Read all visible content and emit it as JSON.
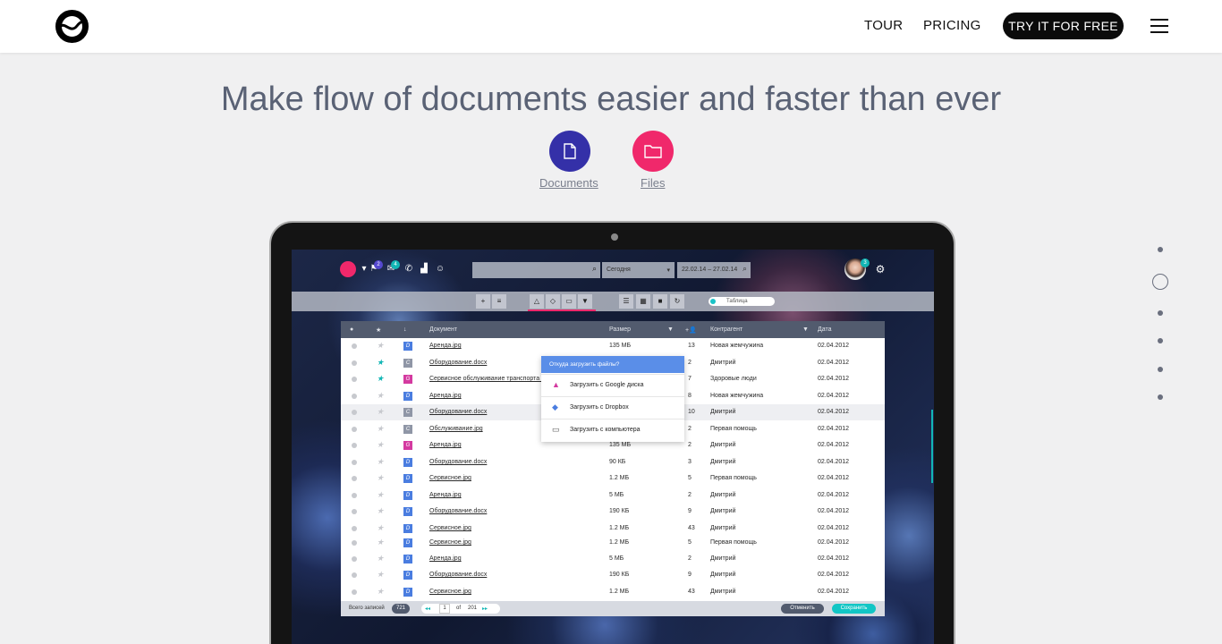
{
  "nav": {
    "tour": "TOUR",
    "pricing": "PRICING",
    "cta": "TRY IT FOR FREE"
  },
  "hero": {
    "headline": "Make flow of documents easier and faster than ever"
  },
  "features": [
    {
      "label": "Documents",
      "color": "#3430a8"
    },
    {
      "label": "Files",
      "color": "#f0286b"
    }
  ],
  "app": {
    "search_icon": "search-icon",
    "period_select": "Сегодня",
    "date_range": "22.02.14 – 27.02.14",
    "badges": {
      "flag": "2",
      "mail": "4",
      "avatar": "3"
    },
    "toggle_label": "Таблица",
    "columns": {
      "document": "Документ",
      "size": "Размер",
      "contractor": "Контрагент",
      "date": "Дата"
    },
    "rows": [
      {
        "type": "D",
        "name": "Аренда.jpg",
        "size": "135 МБ",
        "count": "13",
        "contractor": "Новая жемчужина",
        "date": "02.04.2012",
        "star": false
      },
      {
        "type": "С",
        "name": "Оборудование.docx",
        "size": "",
        "count": "2",
        "contractor": "Дмитрий",
        "date": "02.04.2012",
        "star": true
      },
      {
        "type": "G",
        "name": "Сервисное обслуживание транспорта ком",
        "size": "",
        "count": "7",
        "contractor": "Здоровые люди",
        "date": "02.04.2012",
        "star": true
      },
      {
        "type": "D",
        "name": "Аренда.jpg",
        "size": "",
        "count": "8",
        "contractor": "Новая жемчужина",
        "date": "02.04.2012",
        "star": false
      },
      {
        "type": "С",
        "name": "Оборудование.docx",
        "size": "",
        "count": "10",
        "contractor": "Дмитрий",
        "date": "02.04.2012",
        "star": false
      },
      {
        "type": "С",
        "name": "Обслуживание.jpg",
        "size": "",
        "count": "2",
        "contractor": "Первая помощь",
        "date": "02.04.2012",
        "star": false
      },
      {
        "type": "G",
        "name": "Аренда.jpg",
        "size": "135 МБ",
        "count": "2",
        "contractor": "Дмитрий",
        "date": "02.04.2012",
        "star": false
      },
      {
        "type": "D",
        "name": "Оборудование.docx",
        "size": "90 КБ",
        "count": "3",
        "contractor": "Дмитрий",
        "date": "02.04.2012",
        "star": false
      },
      {
        "type": "D",
        "name": "Сервисное.jpg",
        "size": "1.2 МБ",
        "count": "5",
        "contractor": "Первая помощь",
        "date": "02.04.2012",
        "star": false
      },
      {
        "type": "D",
        "name": "Аренда.jpg",
        "size": "5 МБ",
        "count": "2",
        "contractor": "Дмитрий",
        "date": "02.04.2012",
        "star": false
      },
      {
        "type": "D",
        "name": "Оборудование.docx",
        "size": "190 КБ",
        "count": "9",
        "contractor": "Дмитрий",
        "date": "02.04.2012",
        "star": false
      },
      {
        "type": "D",
        "name": "Сервисное.jpg",
        "size": "1.2 МБ",
        "count": "43",
        "contractor": "Дмитрий",
        "date": "02.04.2012",
        "star": false
      },
      {
        "type": "D",
        "name": "Сервисное.jpg",
        "size": "1.2 МБ",
        "count": "5",
        "contractor": "Первая помощь",
        "date": "02.04.2012",
        "star": false
      },
      {
        "type": "D",
        "name": "Аренда.jpg",
        "size": "5 МБ",
        "count": "2",
        "contractor": "Дмитрий",
        "date": "02.04.2012",
        "star": false
      },
      {
        "type": "D",
        "name": "Оборудование.docx",
        "size": "190 КБ",
        "count": "9",
        "contractor": "Дмитрий",
        "date": "02.04.2012",
        "star": false
      },
      {
        "type": "D",
        "name": "Сервисное.jpg",
        "size": "1.2 МБ",
        "count": "43",
        "contractor": "Дмитрий",
        "date": "02.04.2012",
        "star": false
      }
    ],
    "footer": {
      "total_label": "Всего записей",
      "total": "721",
      "page": "1",
      "of": "of",
      "pages": "201",
      "cancel": "Отменить",
      "save": "Сохранить"
    },
    "upload_popup": {
      "title": "Откуда загрузить файлы?",
      "items": [
        "Загрузить с Google диска",
        "Загрузить с Dropbox",
        "Загрузить с компьютера"
      ]
    }
  }
}
